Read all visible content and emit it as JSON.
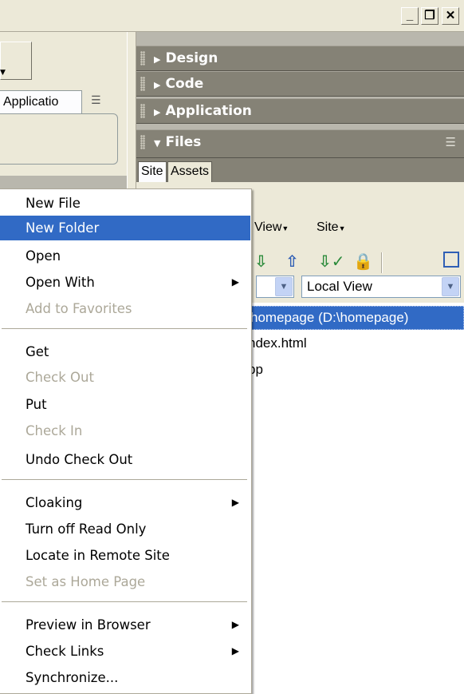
{
  "window": {
    "minimize_glyph": "_",
    "restore_glyph": "❐",
    "close_glyph": "✕"
  },
  "left_panel": {
    "tab_label": "Applicatio",
    "menu_icon": "list-menu-icon"
  },
  "panels": {
    "design": "Design",
    "code": "Code",
    "application": "Application",
    "files": "Files"
  },
  "files": {
    "tabs": [
      "Site",
      "Assets"
    ],
    "menus": [
      "View",
      "Site"
    ],
    "view_select": "Local View",
    "tree": [
      "homepage (D:\\homepage)",
      "ndex.html",
      "pp"
    ]
  },
  "context_menu": {
    "items": [
      {
        "label": "New File"
      },
      {
        "label": "New Folder",
        "highlighted": true
      },
      {
        "label": "Open"
      },
      {
        "label": "Open With",
        "submenu": true
      },
      {
        "label": "Add to Favorites",
        "disabled": true
      },
      {
        "label": "Get"
      },
      {
        "label": "Check Out",
        "disabled": true
      },
      {
        "label": "Put"
      },
      {
        "label": "Check In",
        "disabled": true
      },
      {
        "label": "Undo Check Out"
      },
      {
        "label": "Cloaking",
        "submenu": true
      },
      {
        "label": "Turn off Read Only"
      },
      {
        "label": "Locate in Remote Site"
      },
      {
        "label": "Set as Home Page",
        "disabled": true
      },
      {
        "label": "Preview in Browser",
        "submenu": true
      },
      {
        "label": "Check Links",
        "submenu": true
      },
      {
        "label": "Synchronize..."
      }
    ]
  },
  "colors": {
    "highlight": "#316ac5",
    "panel_header": "#858276",
    "disabled_text": "#aca899",
    "chrome": "#ece9d8"
  }
}
